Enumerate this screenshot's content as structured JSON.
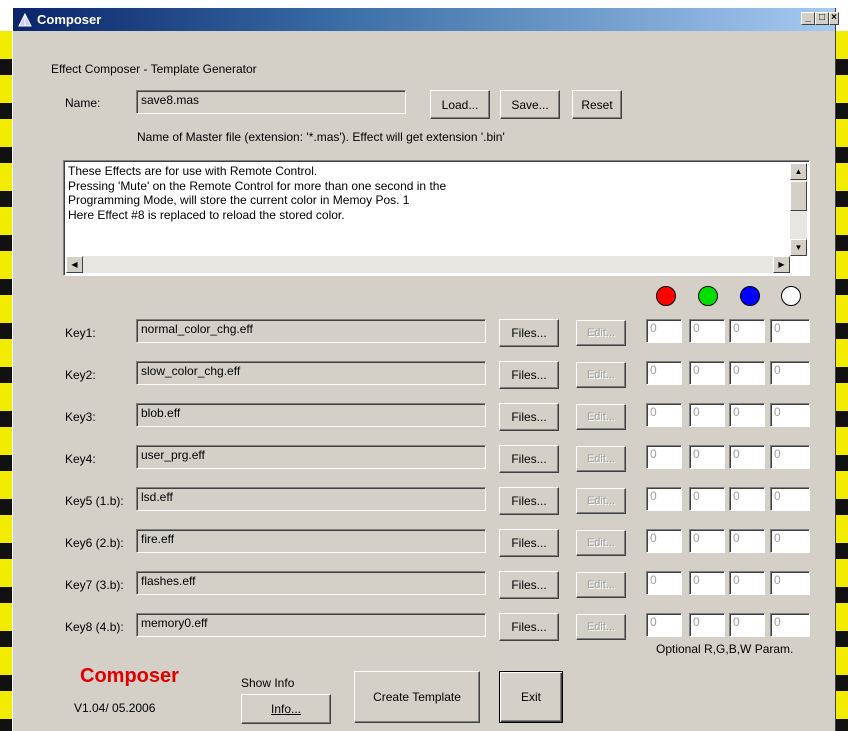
{
  "window": {
    "title": "Composer",
    "controls": [
      "_",
      "□",
      "×"
    ]
  },
  "header": {
    "heading": "Effect Composer - Template Generator",
    "name_label": "Name:",
    "name_value": "save8.mas",
    "load_label": "Load...",
    "save_label": "Save...",
    "reset_label": "Reset",
    "hint": "Name of Master file (extension: '*.mas'). Effect will get extension '.bin'"
  },
  "info_text": {
    "lines": [
      "These Effects are for use with Remote Control.",
      "Pressing 'Mute' on the Remote Control for more than one second in the",
      "Programming Mode, will store the current color in Memoy Pos. 1",
      "Here Effect #8 is replaced to reload the stored color."
    ]
  },
  "color_dots": [
    {
      "name": "red",
      "color": "#ff0000"
    },
    {
      "name": "green",
      "color": "#00e000"
    },
    {
      "name": "blue",
      "color": "#0000ff"
    },
    {
      "name": "white",
      "color": "#ffffff"
    }
  ],
  "keys": [
    {
      "label": "Key1:",
      "file": "normal_color_chg.eff",
      "files_label": "Files...",
      "edit_label": "Edit...",
      "params": [
        "0",
        "0",
        "0",
        "0"
      ]
    },
    {
      "label": "Key2:",
      "file": "slow_color_chg.eff",
      "files_label": "Files...",
      "edit_label": "Edit...",
      "params": [
        "0",
        "0",
        "0",
        "0"
      ]
    },
    {
      "label": "Key3:",
      "file": "blob.eff",
      "files_label": "Files...",
      "edit_label": "Edit...",
      "params": [
        "0",
        "0",
        "0",
        "0"
      ]
    },
    {
      "label": "Key4:",
      "file": "user_prg.eff",
      "files_label": "Files...",
      "edit_label": "Edit...",
      "params": [
        "0",
        "0",
        "0",
        "0"
      ]
    },
    {
      "label": "Key5 (1.b):",
      "file": "lsd.eff",
      "files_label": "Files...",
      "edit_label": "Edit...",
      "params": [
        "0",
        "0",
        "0",
        "0"
      ]
    },
    {
      "label": "Key6 (2.b):",
      "file": "fire.eff",
      "files_label": "Files...",
      "edit_label": "Edit...",
      "params": [
        "0",
        "0",
        "0",
        "0"
      ]
    },
    {
      "label": "Key7 (3.b):",
      "file": "flashes.eff",
      "files_label": "Files...",
      "edit_label": "Edit...",
      "params": [
        "0",
        "0",
        "0",
        "0"
      ]
    },
    {
      "label": "Key8 (4.b):",
      "file": "memory0.eff",
      "files_label": "Files...",
      "edit_label": "Edit...",
      "params": [
        "0",
        "0",
        "0",
        "0"
      ]
    }
  ],
  "params_caption": "Optional R,G,B,W Param.",
  "footer": {
    "brand": "Composer",
    "version": "V1.04/ 05.2006",
    "show_info_label": "Show Info",
    "info_button": "Info...",
    "create_template": "Create Template",
    "exit": "Exit"
  },
  "colors": {
    "titlebar_start": "#0a246a",
    "titlebar_end": "#a6caf0",
    "window_bg": "#d4d0c8",
    "brand": "#e00000",
    "stripe_yellow": "#f4ec00"
  }
}
